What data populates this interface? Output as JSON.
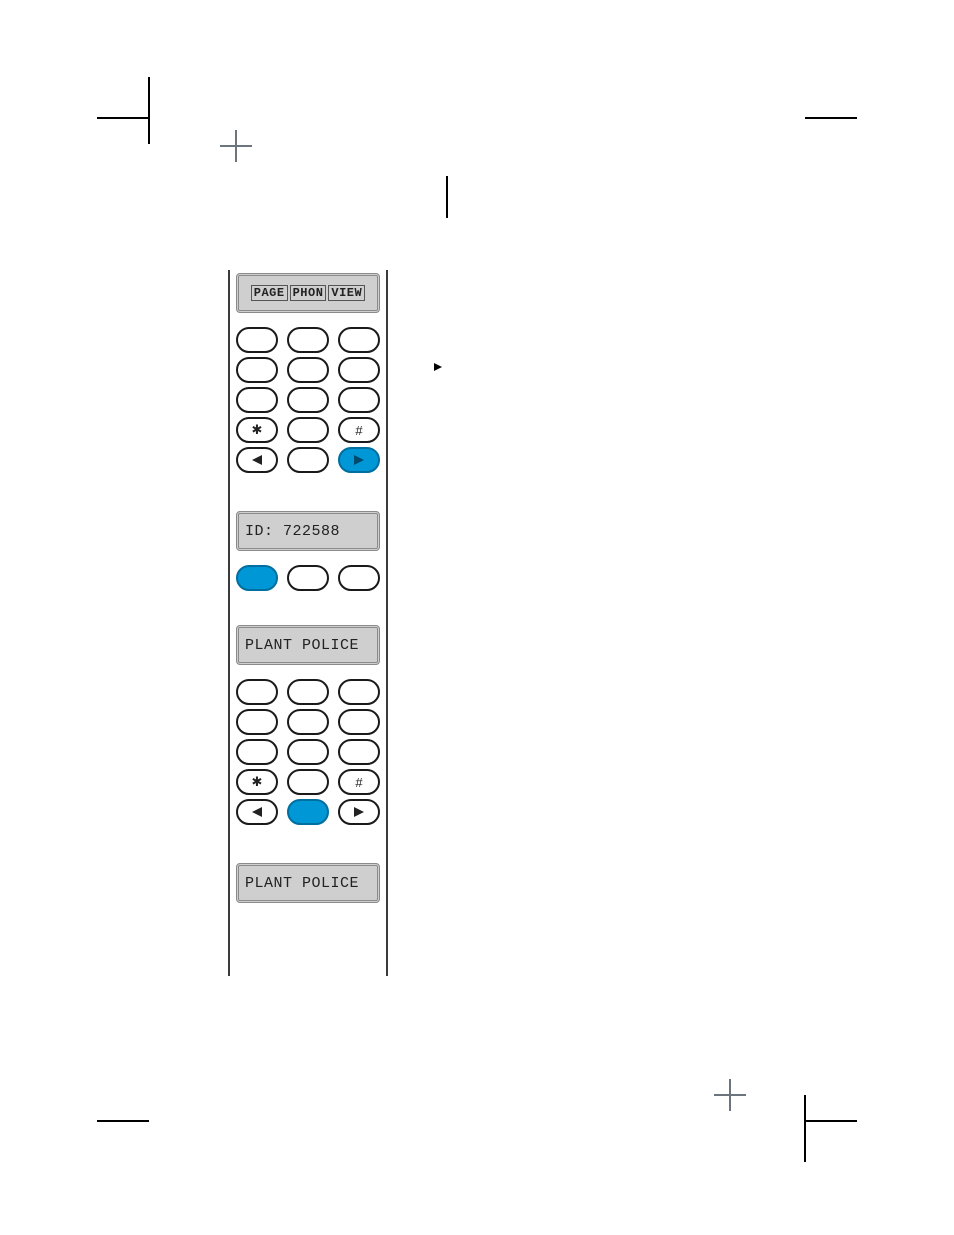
{
  "step1": {
    "lcd_segments": [
      "PAGE",
      "PHON",
      "VIEW"
    ],
    "keys_with_glyph": {
      "star": "✱",
      "hash": "#",
      "left": "◀",
      "right": "▶"
    },
    "highlighted_key": "right"
  },
  "step2": {
    "lcd_text": "ID: 722588",
    "highlighted_key": "one"
  },
  "step3": {
    "lcd_text": "PLANT POLICE",
    "keys_with_glyph": {
      "star": "✱",
      "hash": "#",
      "left": "◀",
      "right": "▶"
    },
    "highlighted_key": "zero"
  },
  "step4": {
    "lcd_text": "PLANT POLICE"
  }
}
